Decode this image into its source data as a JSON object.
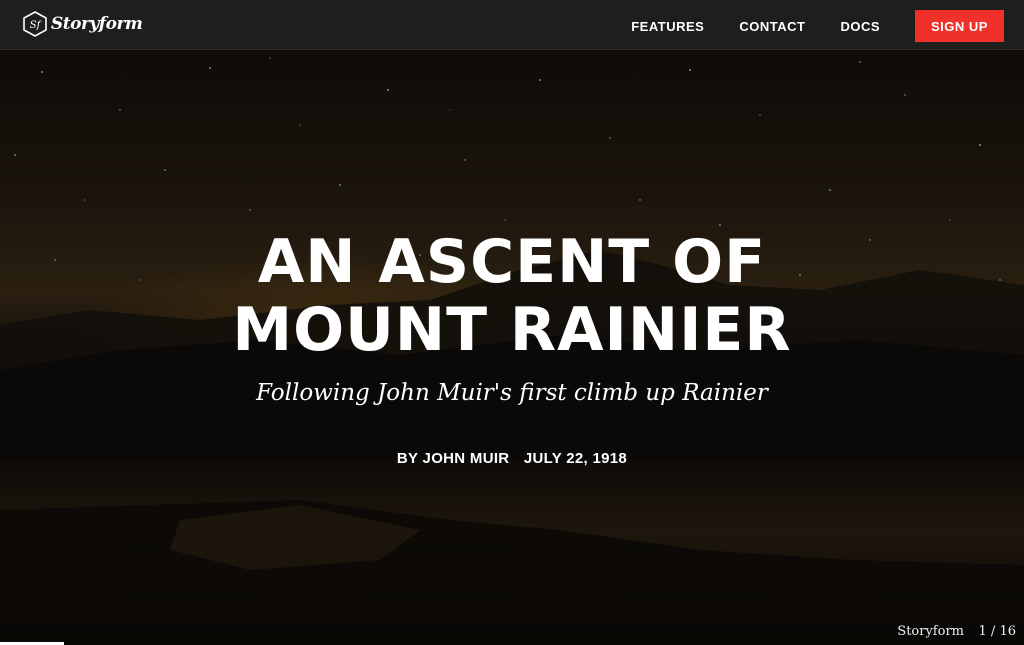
{
  "brand": {
    "name": "Storyform",
    "logo_text": "Sf"
  },
  "nav": {
    "features": "FEATURES",
    "contact": "CONTACT",
    "docs": "DOCS",
    "signup": "SIGN UP"
  },
  "colors": {
    "accent": "#f0302a",
    "topbar": "#1e1e1e"
  },
  "article": {
    "title_line1": "AN ASCENT OF",
    "title_line2": "MOUNT RAINIER",
    "subtitle": "Following John Muir's first climb up Rainier",
    "author": "BY JOHN MUIR",
    "date": "JULY 22, 1918"
  },
  "footer": {
    "brand": "Storyform",
    "page_indicator": "1 / 16",
    "progress_fraction": 0.0625
  }
}
